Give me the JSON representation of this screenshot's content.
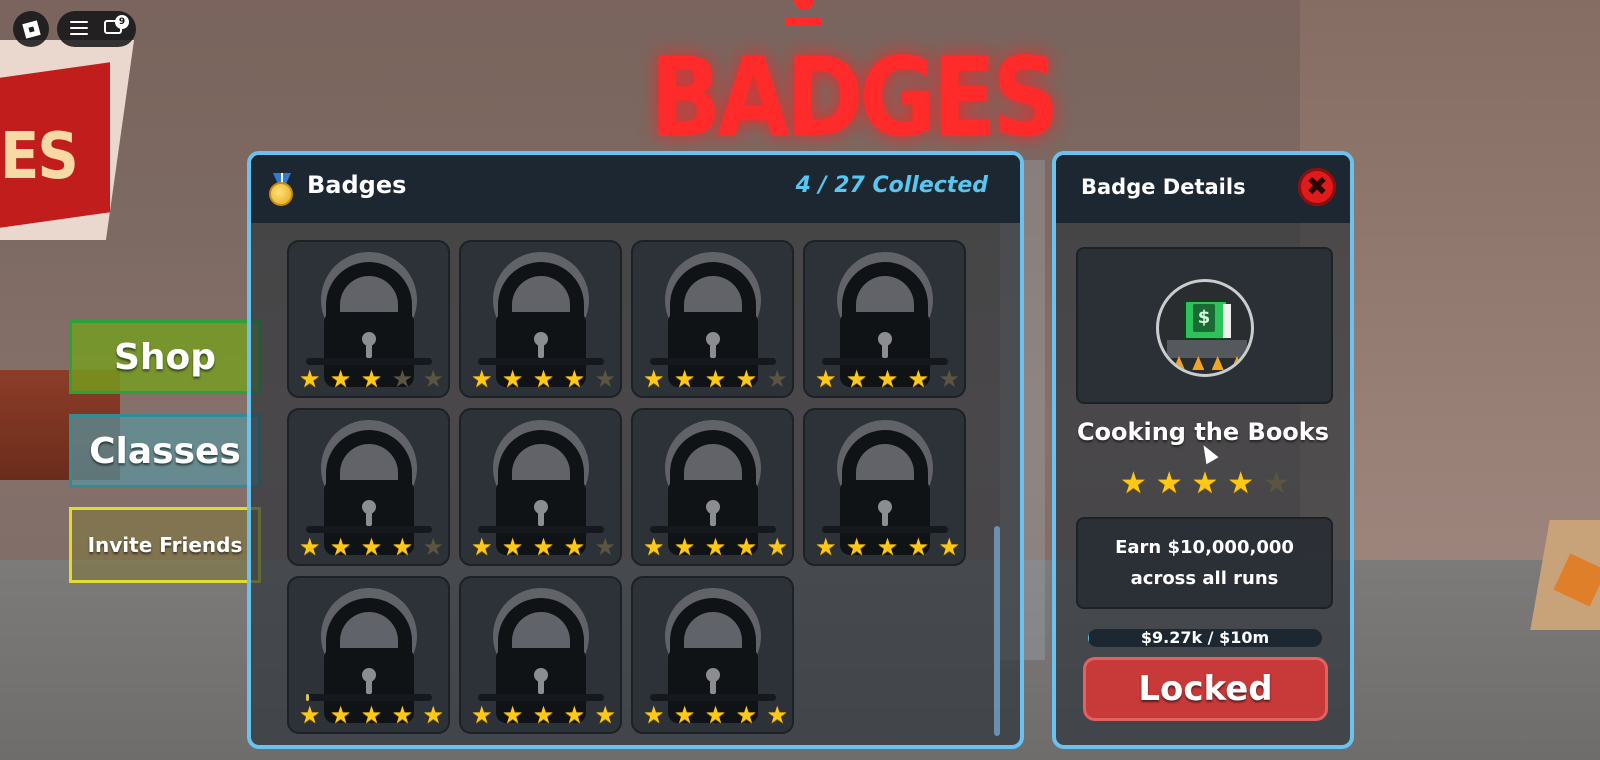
{
  "scene": {
    "sign_title": "BADGES",
    "left_sign_text": "ES"
  },
  "topbar": {
    "chat_badge_count": "9"
  },
  "side_menu": {
    "shop": "Shop",
    "classes": "Classes",
    "invite": "Invite Friends"
  },
  "badges_panel": {
    "title": "Badges",
    "collected": "4 / 27 Collected",
    "tiles": [
      {
        "stars": 3,
        "max_stars": 5,
        "progress": 0
      },
      {
        "stars": 4,
        "max_stars": 5,
        "progress": 0
      },
      {
        "stars": 4,
        "max_stars": 5,
        "progress": 0
      },
      {
        "stars": 4,
        "max_stars": 5,
        "progress": 0
      },
      {
        "stars": 4,
        "max_stars": 5,
        "progress": 0
      },
      {
        "stars": 4,
        "max_stars": 5,
        "progress": 0
      },
      {
        "stars": 5,
        "max_stars": 5,
        "progress": 0
      },
      {
        "stars": 5,
        "max_stars": 5,
        "progress": 0
      },
      {
        "stars": 5,
        "max_stars": 5,
        "progress": 0.02
      },
      {
        "stars": 5,
        "max_stars": 5,
        "progress": 0
      },
      {
        "stars": 5,
        "max_stars": 5,
        "progress": 0
      }
    ]
  },
  "details": {
    "title": "Badge Details",
    "badge_name": "Cooking the Books",
    "stars": 4,
    "max_stars": 5,
    "description": "Earn $10,000,000 across all runs",
    "progress_text": "$9.27k / $10m",
    "progress_fraction": 0.001,
    "status_button": "Locked"
  },
  "colors": {
    "accent": "#6ac3ee",
    "star": "#ffc815",
    "locked": "#c83a3a",
    "title_red": "#ff2a2a"
  }
}
